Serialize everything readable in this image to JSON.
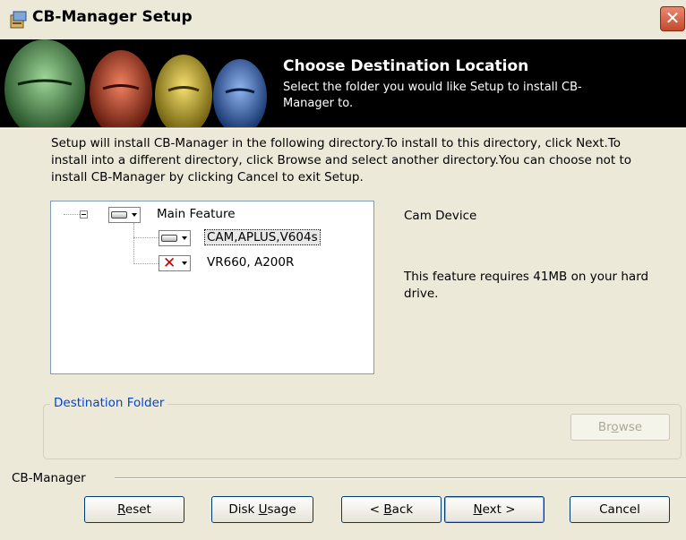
{
  "window": {
    "title": "CB-Manager Setup",
    "close_glyph": "✕"
  },
  "banner": {
    "title": "Choose Destination Location",
    "subtitle": "Select the folder you would like Setup to install CB-Manager to."
  },
  "intro": "Setup will install CB-Manager in the following directory.To install to this directory, click Next.To install into a different directory, click Browse and select another directory.You can choose not to install CB-Manager by clicking Cancel to exit Setup.",
  "tree": {
    "items": [
      {
        "label": "Main Feature",
        "icon": "drive-icon",
        "state": "install"
      },
      {
        "label": "CAM,APLUS,V604s",
        "icon": "drive-icon",
        "state": "install",
        "selected": true
      },
      {
        "label": "VR660, A200R",
        "icon": "x-icon",
        "state": "not-available"
      }
    ]
  },
  "description": {
    "name": "Cam Device",
    "requirement": "This feature requires 41MB on your hard drive."
  },
  "destination": {
    "legend": "Destination Folder",
    "browse_pre": "Br",
    "browse_u": "o",
    "browse_post": "wse"
  },
  "footer": {
    "label": "CB-Manager"
  },
  "buttons": {
    "reset": {
      "u": "R",
      "rest": "eset"
    },
    "disk_usage": {
      "pre": "Disk ",
      "u": "U",
      "rest": "sage"
    },
    "back": {
      "pre": "< ",
      "u": "B",
      "rest": "ack"
    },
    "next": {
      "u": "N",
      "rest": "ext >"
    },
    "cancel": "Cancel"
  }
}
